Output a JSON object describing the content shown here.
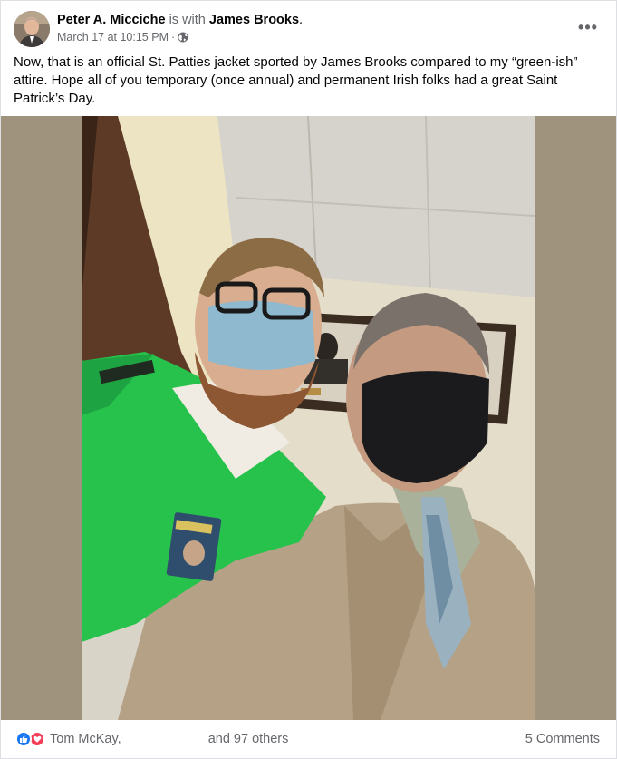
{
  "post": {
    "author": "Peter A. Micciche",
    "with_text": "is with",
    "tagged": "James Brooks",
    "tagged_suffix": ".",
    "timestamp": "March 17 at 10:15 PM",
    "separator": "·",
    "privacy_icon": "globe-icon",
    "more_icon": "•••",
    "text": "Now, that is an official St. Patties jacket sported by James Brooks compared to my “green-ish” attire. Hope all of you temporary (once annual) and permanent Irish folks had a great Saint Patrick’s Day."
  },
  "footer": {
    "reaction_icons": [
      "like-icon",
      "love-icon"
    ],
    "reactor_first": "Tom McKay,",
    "reactor_tail": "and 97 others",
    "comments": "5 Comments"
  },
  "colors": {
    "like": "#1877f2",
    "love": "#f33e58",
    "secondary_text": "#65676b",
    "photo_background": "#a0937d"
  }
}
